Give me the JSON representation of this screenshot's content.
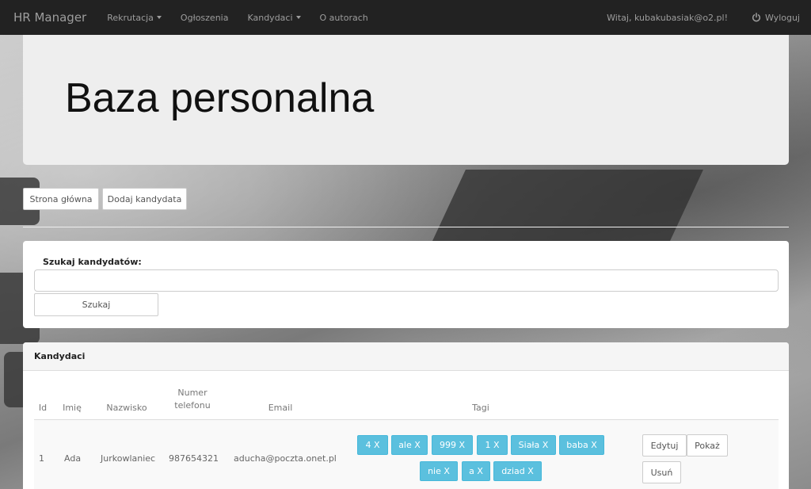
{
  "navbar": {
    "brand": "HR Manager",
    "items": [
      {
        "label": "Rekrutacja",
        "dropdown": true
      },
      {
        "label": "Ogłoszenia",
        "dropdown": false
      },
      {
        "label": "Kandydaci",
        "dropdown": true
      },
      {
        "label": "O autorach",
        "dropdown": false
      }
    ],
    "greeting": "Witaj, kubakubasiak@o2.pl!",
    "logout_label": "Wyloguj",
    "logout_icon": "power-icon"
  },
  "jumbotron": {
    "title": "Baza personalna"
  },
  "actions": {
    "home_label": "Strona główna",
    "add_label": "Dodaj kandydata"
  },
  "search": {
    "title": "Szukaj kandydatów:",
    "value": "",
    "placeholder": "",
    "button_label": "Szukaj"
  },
  "candidates": {
    "panel_title": "Kandydaci",
    "headers": {
      "id": "Id",
      "first_name": "Imię",
      "last_name": "Nazwisko",
      "phone_line1": "Numer",
      "phone_line2": "telefonu",
      "email": "Email",
      "tags": "Tagi"
    },
    "rows": [
      {
        "id": "1",
        "first_name": "Ada",
        "last_name": "Jurkowlaniec",
        "phone": "987654321",
        "email": "aducha@poczta.onet.pl",
        "tags": [
          "4 X",
          "ale X",
          "999 X",
          "1 X",
          "Siała X",
          "baba X",
          "nie X",
          "a X",
          "dziad X"
        ],
        "edit_label": "Edytuj",
        "show_label": "Pokaż",
        "delete_label": "Usuń"
      }
    ]
  },
  "colors": {
    "navbar": "#222222",
    "navbar_text": "#9d9d9d",
    "jumbotron": "#eeeeee",
    "tag_info": "#5bc0de"
  }
}
